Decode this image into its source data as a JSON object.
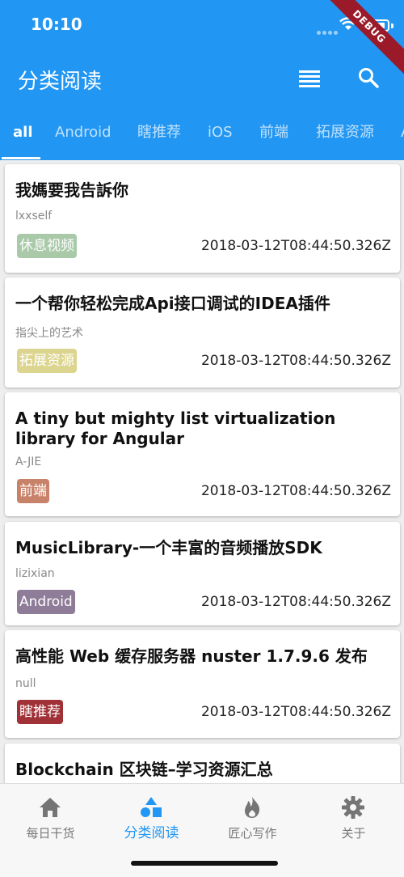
{
  "status": {
    "time": "10:10"
  },
  "debug_banner": "DEBUG",
  "appbar": {
    "title": "分类阅读"
  },
  "tabs": [
    {
      "label": "all",
      "active": true
    },
    {
      "label": "Android"
    },
    {
      "label": "瞎推荐"
    },
    {
      "label": "iOS"
    },
    {
      "label": "前端"
    },
    {
      "label": "拓展资源"
    },
    {
      "label": "A"
    }
  ],
  "articles": [
    {
      "title": "我媽要我告訴你",
      "author": "lxxself",
      "tag": "休息视频",
      "tag_color": "#a9c9a9",
      "date": "2018-03-12T08:44:50.326Z"
    },
    {
      "title": "一个帮你轻松完成Api接口调试的IDEA插件",
      "author": "指尖上的艺术",
      "tag": "拓展资源",
      "tag_color": "#dcd590",
      "date": "2018-03-12T08:44:50.326Z"
    },
    {
      "title": "A tiny but mighty list virtualization library for Angular",
      "author": "A-JIE",
      "tag": "前端",
      "tag_color": "#c9826a",
      "date": "2018-03-12T08:44:50.326Z"
    },
    {
      "title": "MusicLibrary-一个丰富的音频播放SDK",
      "author": "lizixian",
      "tag": "Android",
      "tag_color": "#8e7c98",
      "date": "2018-03-12T08:44:50.326Z"
    },
    {
      "title": "高性能 Web 缓存服务器 nuster 1.7.9.6 发布",
      "author": "null",
      "tag": "瞎推荐",
      "tag_color": "#a03137",
      "date": "2018-03-12T08:44:50.326Z"
    },
    {
      "title": "Blockchain 区块链–学习资源汇总"
    }
  ],
  "bottom_nav": [
    {
      "label": "每日干货",
      "icon": "home-icon"
    },
    {
      "label": "分类阅读",
      "icon": "category-icon",
      "active": true
    },
    {
      "label": "匠心写作",
      "icon": "fire-icon"
    },
    {
      "label": "关于",
      "icon": "gear-icon"
    }
  ],
  "colors": {
    "primary": "#2196f3",
    "background": "#eeeeee"
  }
}
